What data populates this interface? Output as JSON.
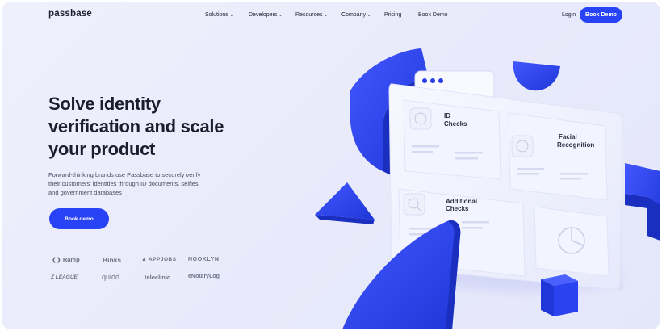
{
  "brand": {
    "logo": "passbase",
    "accent": "#2743f5"
  },
  "nav": {
    "items": [
      {
        "label": "Solutions",
        "dropdown": true
      },
      {
        "label": "Developers",
        "dropdown": true
      },
      {
        "label": "Resources",
        "dropdown": true
      },
      {
        "label": "Company",
        "dropdown": true
      },
      {
        "label": "Pricing",
        "dropdown": false
      },
      {
        "label": "Book Demo",
        "dropdown": false
      }
    ],
    "login": "Login",
    "cta": "Book Demo"
  },
  "hero": {
    "title": "Solve identity verification and scale your product",
    "subtitle": "Forward-thinking brands use Passbase to securely verify their customers' identities through ID documents, selfies, and government databases",
    "cta": "Book demo"
  },
  "clients": [
    "Ramp",
    "Binks",
    "APPJOBS",
    "NOOKLYN",
    "Z LEAGUE",
    "quidd",
    "teleclinic",
    "eNotaryLog"
  ],
  "illustration": {
    "cards": [
      {
        "label_line1": "ID",
        "label_line2": "Checks"
      },
      {
        "label_line1": "Facial",
        "label_line2": "Recognition"
      },
      {
        "label_line1": "Additional",
        "label_line2": "Checks"
      }
    ]
  }
}
